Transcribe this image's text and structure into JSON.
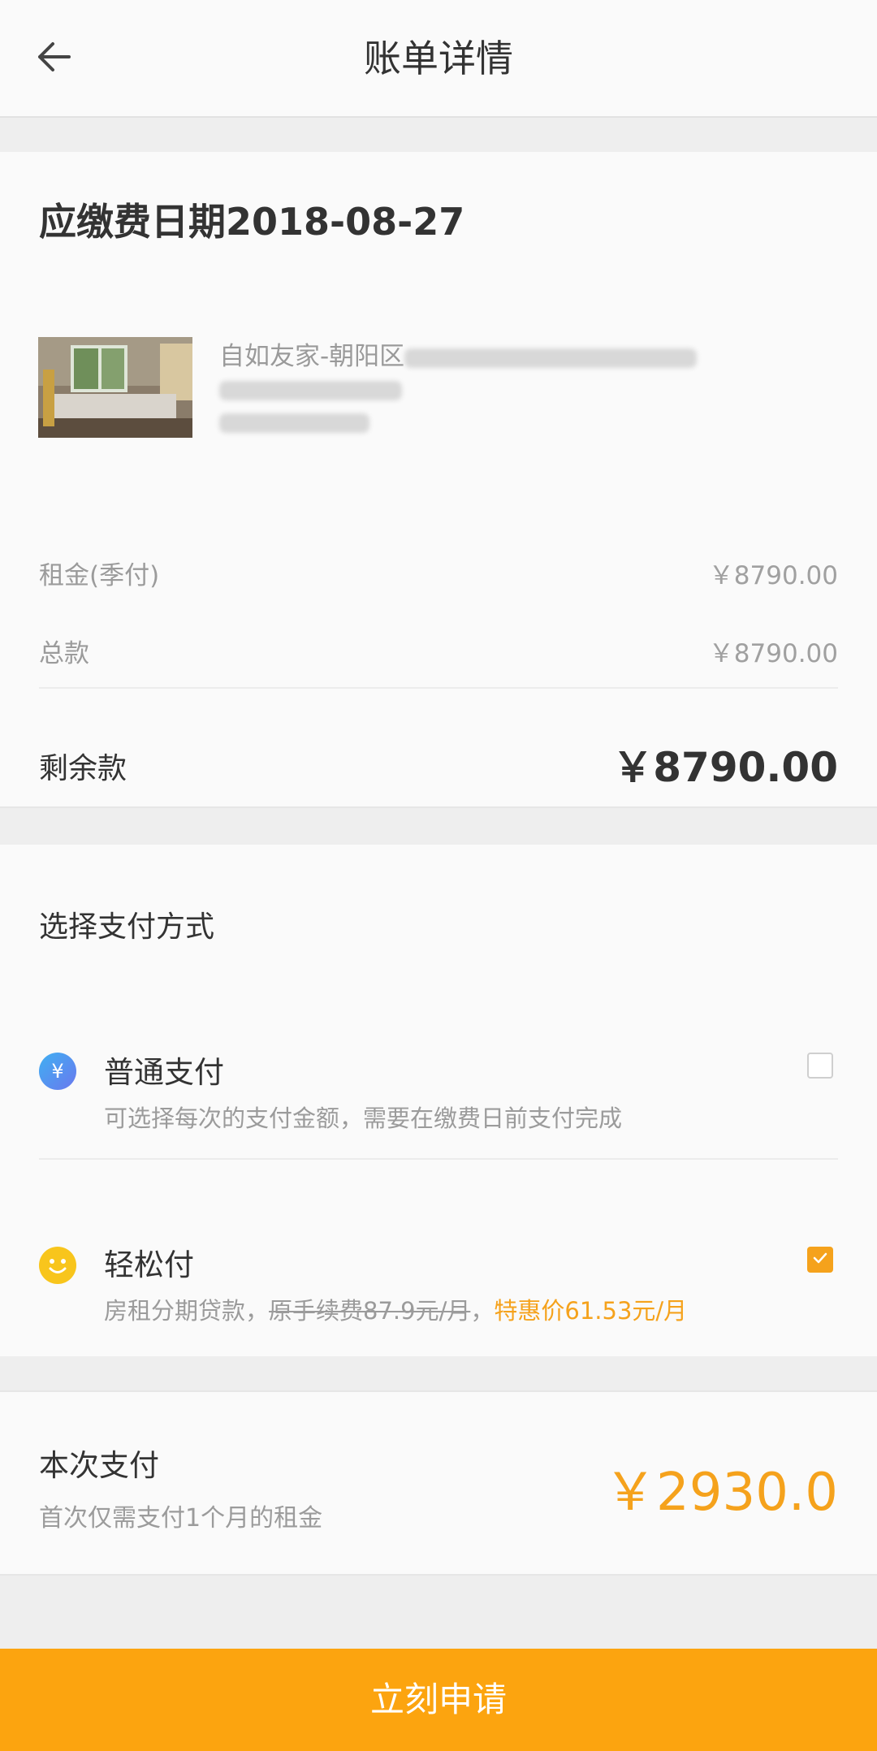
{
  "header": {
    "title": "账单详情"
  },
  "bill": {
    "due_title": "应缴费日期2018-08-27",
    "house": {
      "line1": "自如友家-朝阳区"
    },
    "rent_label": "租金(季付)",
    "rent_value": "￥8790.00",
    "total_label": "总款",
    "total_value": "￥8790.00",
    "remaining_label": "剩余款",
    "remaining_value": "￥8790.00"
  },
  "payment": {
    "section_title": "选择支付方式",
    "options": [
      {
        "name": "普通支付",
        "desc": "可选择每次的支付金额，需要在缴费日前支付完成",
        "icon": "yen-icon",
        "icon_color": "#4f8ff0",
        "checked": false
      },
      {
        "name": "轻松付",
        "desc_prefix": "房租分期贷款，",
        "desc_strike": "原手续费87.9元/月",
        "desc_sep": "，",
        "desc_promo": "特惠价61.53元/月",
        "icon": "smile-icon",
        "icon_color": "#f8c51c",
        "checked": true
      }
    ]
  },
  "summary": {
    "label": "本次支付",
    "note": "首次仅需支付1个月的租金",
    "amount": "￥2930.0"
  },
  "action": {
    "apply_label": "立刻申请"
  },
  "colors": {
    "accent": "#f5a21c",
    "button": "#fca40f"
  }
}
